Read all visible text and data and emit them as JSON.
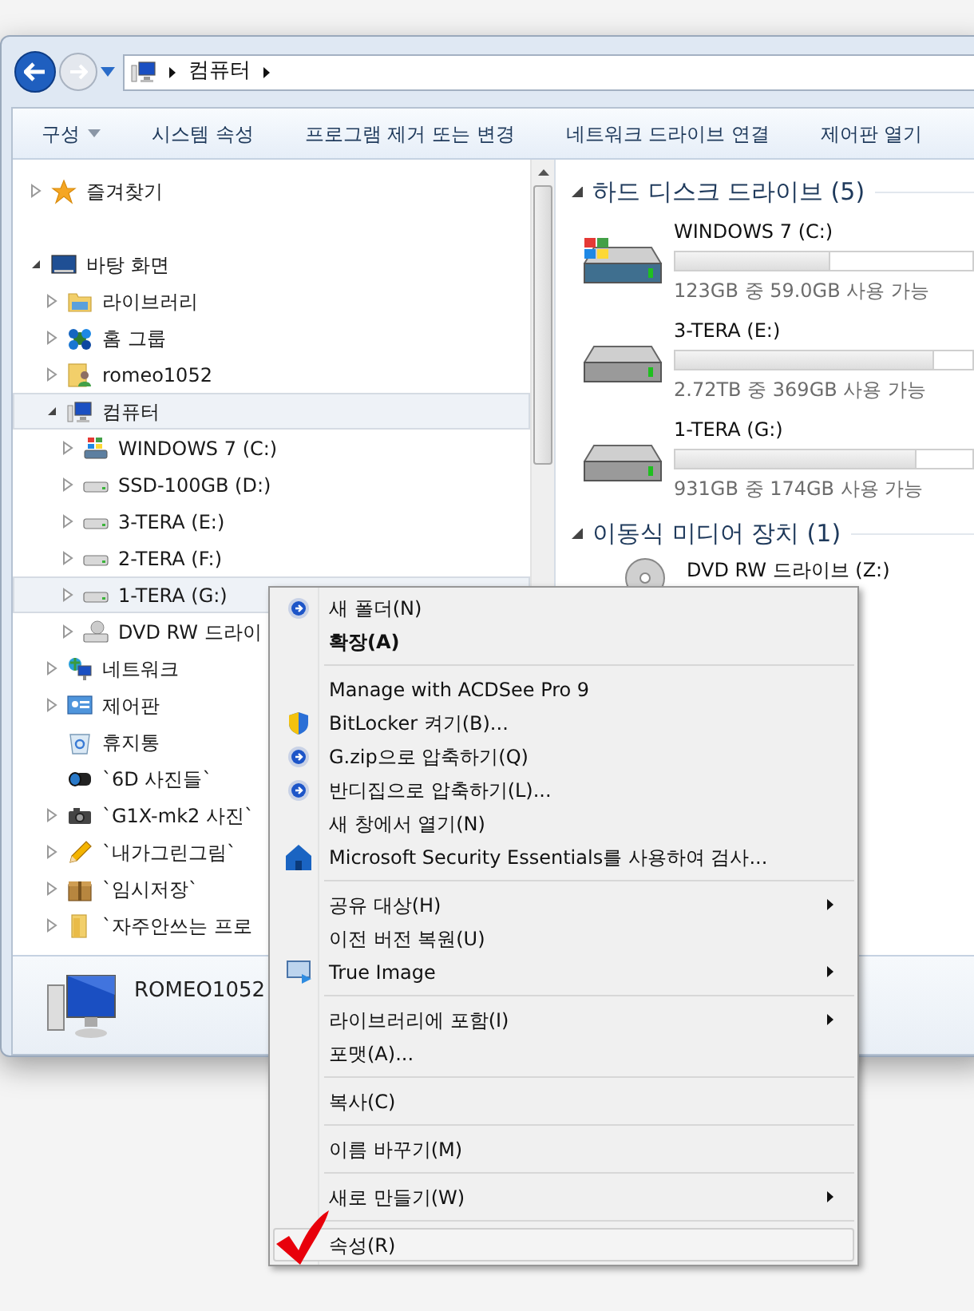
{
  "address_bar": {
    "path": [
      {
        "label": "컴퓨터"
      }
    ]
  },
  "toolbar": {
    "items": [
      {
        "label": "구성",
        "dropdown": true
      },
      {
        "label": "시스템 속성",
        "dropdown": false
      },
      {
        "label": "프로그램 제거 또는 변경",
        "dropdown": false
      },
      {
        "label": "네트워크 드라이브 연결",
        "dropdown": false
      },
      {
        "label": "제어판 열기",
        "dropdown": false
      }
    ]
  },
  "navigation_tree": [
    {
      "label": "즐겨찾기",
      "kind": "favorites",
      "expanded": false,
      "highlighted": false
    },
    {
      "label": "바탕 화면",
      "kind": "desktop",
      "expanded": true,
      "highlighted": false,
      "children": [
        {
          "label": "라이브러리",
          "kind": "library",
          "expanded": false,
          "highlighted": false
        },
        {
          "label": "홈 그룹",
          "kind": "homegroup",
          "expanded": false,
          "highlighted": false
        },
        {
          "label": "romeo1052",
          "kind": "user",
          "expanded": false,
          "highlighted": false
        },
        {
          "label": "컴퓨터",
          "kind": "computer",
          "expanded": true,
          "highlighted": true,
          "children": [
            {
              "label": "WINDOWS 7 (C:)",
              "kind": "windows-drive",
              "expanded": false,
              "highlighted": false
            },
            {
              "label": "SSD-100GB (D:)",
              "kind": "drive",
              "expanded": false,
              "highlighted": false
            },
            {
              "label": "3-TERA (E:)",
              "kind": "drive",
              "expanded": false,
              "highlighted": false
            },
            {
              "label": "2-TERA (F:)",
              "kind": "drive",
              "expanded": false,
              "highlighted": false
            },
            {
              "label": "1-TERA (G:)",
              "kind": "drive",
              "expanded": false,
              "highlighted": true
            },
            {
              "label": "DVD RW 드라이",
              "kind": "dvd",
              "expanded": false,
              "highlighted": false
            }
          ]
        },
        {
          "label": "네트워크",
          "kind": "network",
          "expanded": false,
          "highlighted": false
        },
        {
          "label": "제어판",
          "kind": "control-panel",
          "expanded": false,
          "highlighted": false
        },
        {
          "label": "휴지통",
          "kind": "recycle-bin",
          "highlighted": false
        },
        {
          "label": "`6D 사진들`",
          "kind": "lens",
          "highlighted": false
        },
        {
          "label": "`G1X-mk2 사진`",
          "kind": "camera",
          "expanded": false,
          "highlighted": false
        },
        {
          "label": "`내가그린그림`",
          "kind": "pencil",
          "expanded": false,
          "highlighted": false
        },
        {
          "label": "`임시저장`",
          "kind": "box",
          "expanded": false,
          "highlighted": false
        },
        {
          "label": "`자주안쓰는 프로",
          "kind": "folder",
          "expanded": false,
          "highlighted": false
        }
      ]
    }
  ],
  "content": {
    "groups": [
      {
        "title": "하드 디스크 드라이브 (5)",
        "expanded": true,
        "items": [
          {
            "name": "WINDOWS 7 (C:)",
            "kind": "windows-drive",
            "level": 0.52,
            "reading": "123GB 중 59.0GB 사용 가능"
          },
          {
            "name": "3-TERA (E:)",
            "kind": "drive",
            "level": 0.87,
            "reading": "2.72TB 중 369GB 사용 가능"
          },
          {
            "name": "1-TERA (G:)",
            "kind": "drive",
            "level": 0.81,
            "reading": "931GB 중 174GB 사용 가능"
          }
        ]
      },
      {
        "title": "이동식 미디어 장치 (1)",
        "expanded": true,
        "items": [
          {
            "name": "DVD RW 드라이브 (Z:)",
            "kind": "dvd"
          }
        ]
      }
    ]
  },
  "details_pane": {
    "name": "ROMEO1052"
  },
  "context_menu": {
    "items": [
      {
        "kind": "action",
        "label": "새 폴더(N)",
        "bold": false,
        "submenu": false,
        "highlighted": false
      },
      {
        "kind": "plain",
        "label": "확장(A)",
        "bold": true,
        "submenu": false,
        "highlighted": false
      },
      {
        "kind": "separator"
      },
      {
        "kind": "plain",
        "label": "Manage with ACDSee Pro 9",
        "bold": false,
        "submenu": false,
        "highlighted": false
      },
      {
        "kind": "uac",
        "label": "BitLocker 켜기(B)...",
        "bold": false,
        "submenu": false,
        "highlighted": false
      },
      {
        "kind": "action",
        "label": "G.zip으로 압축하기(Q)",
        "bold": false,
        "submenu": false,
        "highlighted": false
      },
      {
        "kind": "action",
        "label": "반디집으로 압축하기(L)...",
        "bold": false,
        "submenu": false,
        "highlighted": false
      },
      {
        "kind": "plain",
        "label": "새 창에서 열기(N)",
        "bold": false,
        "submenu": false,
        "highlighted": false
      },
      {
        "kind": "antivirus",
        "label": "Microsoft Security Essentials를 사용하여 검사...",
        "bold": false,
        "submenu": false,
        "highlighted": false
      },
      {
        "kind": "separator"
      },
      {
        "kind": "plain",
        "label": "공유 대상(H)",
        "bold": false,
        "submenu": true,
        "highlighted": false
      },
      {
        "kind": "plain",
        "label": "이전 버전 복원(U)",
        "bold": false,
        "submenu": false,
        "highlighted": false
      },
      {
        "kind": "backup",
        "label": "True Image",
        "bold": false,
        "submenu": true,
        "highlighted": false
      },
      {
        "kind": "separator"
      },
      {
        "kind": "plain",
        "label": "라이브러리에 포함(I)",
        "bold": false,
        "submenu": true,
        "highlighted": false
      },
      {
        "kind": "plain",
        "label": "포맷(A)...",
        "bold": false,
        "submenu": false,
        "highlighted": false
      },
      {
        "kind": "separator"
      },
      {
        "kind": "plain",
        "label": "복사(C)",
        "bold": false,
        "submenu": false,
        "highlighted": false
      },
      {
        "kind": "separator"
      },
      {
        "kind": "plain",
        "label": "이름 바꾸기(M)",
        "bold": false,
        "submenu": false,
        "highlighted": false
      },
      {
        "kind": "separator"
      },
      {
        "kind": "plain",
        "label": "새로 만들기(W)",
        "bold": false,
        "submenu": true,
        "highlighted": false
      },
      {
        "kind": "separator"
      },
      {
        "kind": "plain",
        "label": "속성(R)",
        "bold": false,
        "submenu": false,
        "highlighted": true
      }
    ]
  }
}
